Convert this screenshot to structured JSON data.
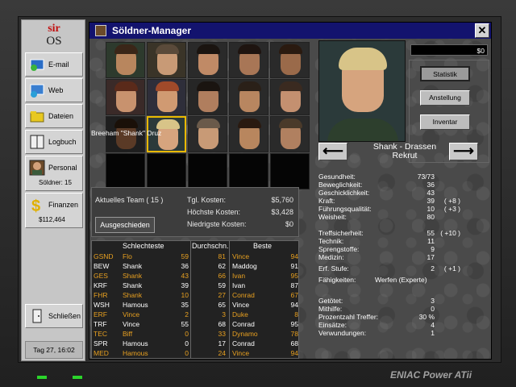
{
  "sidebar": {
    "logo_top": "sir",
    "logo_bottom": "OS",
    "email": "E-mail",
    "web": "Web",
    "files": "Dateien",
    "logbook": "Logbuch",
    "personnel": "Personal",
    "soldiers": "Söldner: 15",
    "finances": "Finanzen",
    "balance": "$112,464",
    "close": "Schließen",
    "date": "Tag 27, 16:02"
  },
  "window": {
    "title": "Söldner-Manager",
    "close_glyph": "✕"
  },
  "portrait": {
    "name": "Breeham \"Shank\" Druz"
  },
  "money": "$0",
  "buttons": {
    "stats": "Statistik",
    "employment": "Anstellung",
    "inventory": "Inventar"
  },
  "nav": {
    "prev": "⟵",
    "next": "⟶",
    "merc_line1": "Shank - Drassen",
    "merc_line2": "Rekrut"
  },
  "team": {
    "current_team": "Aktuelles Team  ( 15 )",
    "dismissed": "Ausgeschieden",
    "daily_cost_label": "Tgl. Kosten:",
    "daily_cost": "$5,760",
    "max_cost_label": "Höchste Kosten:",
    "max_cost": "$3,428",
    "min_cost_label": "Niedrigste Kosten:",
    "min_cost": "$0"
  },
  "table": {
    "headers": [
      "Schlechteste",
      "Durchschn.",
      "Beste"
    ],
    "rows": [
      {
        "code": "GSND",
        "worst": "Flo",
        "worst_v": "59",
        "avg": "81",
        "best": "Vince",
        "best_v": "94",
        "hl": true
      },
      {
        "code": "BEW",
        "worst": "Shank",
        "worst_v": "36",
        "avg": "62",
        "best": "Maddog",
        "best_v": "91",
        "hl": false
      },
      {
        "code": "GES",
        "worst": "Shank",
        "worst_v": "43",
        "avg": "66",
        "best": "Ivan",
        "best_v": "95",
        "hl": true
      },
      {
        "code": "KRF",
        "worst": "Shank",
        "worst_v": "39",
        "avg": "59",
        "best": "Ivan",
        "best_v": "87",
        "hl": false
      },
      {
        "code": "FHR",
        "worst": "Shank",
        "worst_v": "10",
        "avg": "27",
        "best": "Conrad",
        "best_v": "67",
        "hl": true
      },
      {
        "code": "WSH",
        "worst": "Hamous",
        "worst_v": "35",
        "avg": "65",
        "best": "Vince",
        "best_v": "94",
        "hl": false
      },
      {
        "code": "ERF",
        "worst": "Vince",
        "worst_v": "2",
        "avg": "3",
        "best": "Duke",
        "best_v": "8",
        "hl": true
      },
      {
        "code": "TRF",
        "worst": "Vince",
        "worst_v": "55",
        "avg": "68",
        "best": "Conrad",
        "best_v": "95",
        "hl": false
      },
      {
        "code": "TEC",
        "worst": "Biff",
        "worst_v": "0",
        "avg": "33",
        "best": "Dynamo",
        "best_v": "78",
        "hl": true
      },
      {
        "code": "SPR",
        "worst": "Hamous",
        "worst_v": "0",
        "avg": "17",
        "best": "Conrad",
        "best_v": "68",
        "hl": false
      },
      {
        "code": "MED",
        "worst": "Hamous",
        "worst_v": "0",
        "avg": "24",
        "best": "Vince",
        "best_v": "94",
        "hl": true
      }
    ]
  },
  "stats": [
    {
      "k": "Gesundheit:",
      "v": "73/73",
      "b": ""
    },
    {
      "k": "Beweglichkeit:",
      "v": "36",
      "b": ""
    },
    {
      "k": "Geschicklichkeit:",
      "v": "43",
      "b": ""
    },
    {
      "k": "Kraft:",
      "v": "39",
      "b": "( +8 )"
    },
    {
      "k": "Führungsqualität:",
      "v": "10",
      "b": "( +3 )"
    },
    {
      "k": "Weisheit:",
      "v": "80",
      "b": ""
    },
    {
      "k": "Treffsicherheit:",
      "v": "55",
      "b": "( +10 )"
    },
    {
      "k": "Technik:",
      "v": "11",
      "b": ""
    },
    {
      "k": "Sprengstoffe:",
      "v": "9",
      "b": ""
    },
    {
      "k": "Medizin:",
      "v": "17",
      "b": ""
    },
    {
      "k": "Erf. Stufe:",
      "v": "2",
      "b": "( +1 )"
    },
    {
      "k": "Fähigkeiten:",
      "v": "Werfen (Experte)",
      "b": ""
    },
    {
      "k": "Getötet:",
      "v": "3",
      "b": ""
    },
    {
      "k": "Mithilfe:",
      "v": "0",
      "b": ""
    },
    {
      "k": "Prozentzahl Treffer:",
      "v": "30 %",
      "b": ""
    },
    {
      "k": "Einsätze:",
      "v": "4",
      "b": ""
    },
    {
      "k": "Verwundungen:",
      "v": "1",
      "b": ""
    }
  ],
  "brand": "ENIAC Power ATii",
  "colors": {
    "title_bar": "#13136e",
    "highlight_row": "#e8a020",
    "normal_row": "#ffffff",
    "selected_border": "#e8b800"
  }
}
